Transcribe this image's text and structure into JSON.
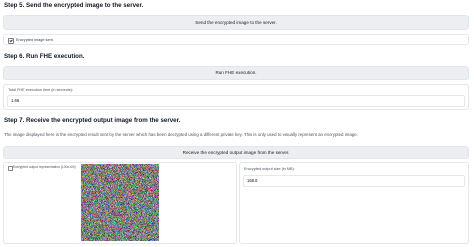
{
  "step5": {
    "heading": "Step 5. Send the encrypted image to the server.",
    "button_label": "Send the encrypted image to the server.",
    "checkbox_label": "Encrypted image sent."
  },
  "step6": {
    "heading": "Step 6. Run FHE execution.",
    "button_label": "Run FHE execution.",
    "time_label": "Total FHE execution time (in seconds):",
    "time_value": "1.66"
  },
  "step7": {
    "heading": "Step 7. Receive the encrypted output image from the server.",
    "description": "The image displayed here is the encrypted result sent by the server which has been decrypted using a different private key. This is only used to visually represent an encrypted image.",
    "button_label": "Receive the encrypted output image from the server.",
    "image_label": "Encrypted output representation (100x100)",
    "size_label": "Encrypted output size (in MB):",
    "size_value": "168.6"
  },
  "icons": {
    "checkbox": "checkbox-checked-icon",
    "image": "image-icon"
  }
}
